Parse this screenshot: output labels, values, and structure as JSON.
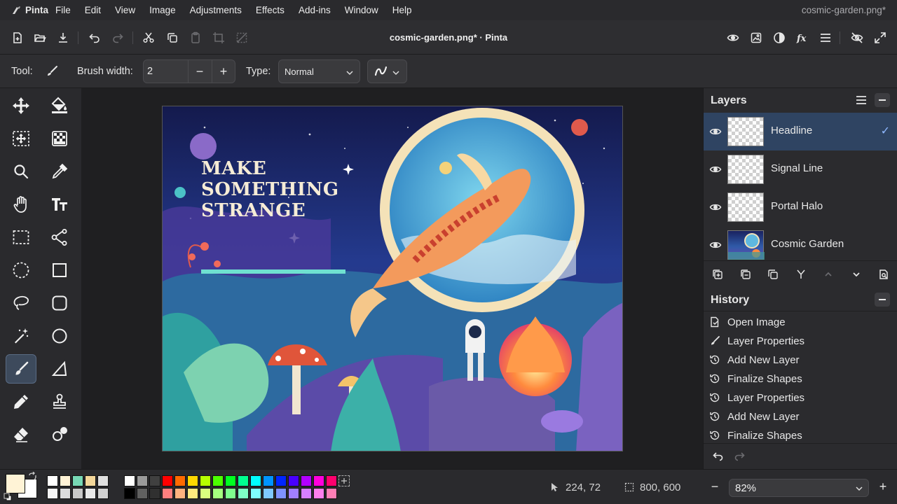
{
  "menubar": {
    "app_name": "Pinta",
    "items": [
      "File",
      "Edit",
      "View",
      "Image",
      "Adjustments",
      "Effects",
      "Add-ins",
      "Window",
      "Help"
    ],
    "window_title": "cosmic-garden.png*"
  },
  "toolbar": {
    "doc_title": "cosmic-garden.png* · Pinta"
  },
  "options": {
    "tool_label": "Tool:",
    "brush_width_label": "Brush width:",
    "brush_width_value": "2",
    "type_label": "Type:",
    "type_value": "Normal"
  },
  "artwork": {
    "headline_lines": [
      "MAKE",
      "SOMETHING",
      "STRANGE"
    ]
  },
  "layers": {
    "title": "Layers",
    "items": [
      {
        "name": "Headline",
        "selected": true
      },
      {
        "name": "Signal Line",
        "selected": false
      },
      {
        "name": "Portal Halo",
        "selected": false
      },
      {
        "name": "Cosmic Garden",
        "selected": false
      }
    ],
    "check": "✓"
  },
  "history": {
    "title": "History",
    "items": [
      "Open Image",
      "Layer Properties",
      "Add New Layer",
      "Finalize Shapes",
      "Layer Properties",
      "Add New Layer",
      "Finalize Shapes"
    ]
  },
  "status": {
    "cursor_position": "224, 72",
    "selection_size": "800, 600",
    "zoom": "82%"
  },
  "colors": {
    "primary": "#fff3d6",
    "secondary": "#ffffff",
    "palette_row1": [
      "#ffffff",
      "#fff3d6",
      "#77d8b5",
      "#f3d79a",
      "#e0e0e0",
      "#ffffff",
      "#9a9a9a",
      "#404040",
      "#ff0000",
      "#ff6a00",
      "#ffd800",
      "#b6ff00",
      "#4cff00",
      "#00ff21",
      "#00ff90",
      "#00ffff",
      "#0094ff",
      "#0026ff",
      "#4800ff",
      "#b200ff",
      "#ff00dc",
      "#ff006e"
    ],
    "palette_row2": [
      "#f5f5f5",
      "#dcdcdc",
      "#c8c8c8",
      "#e8e8e8",
      "#d0d0d0",
      "#000000",
      "#606060",
      "#303030",
      "#ff7f7f",
      "#ffb27f",
      "#ffe97f",
      "#daff7f",
      "#a5ff7f",
      "#7fff8e",
      "#7fffc5",
      "#7fffff",
      "#7fc9ff",
      "#7f92ff",
      "#a17fff",
      "#d67fff",
      "#ff7fed",
      "#ff7fb6"
    ]
  }
}
